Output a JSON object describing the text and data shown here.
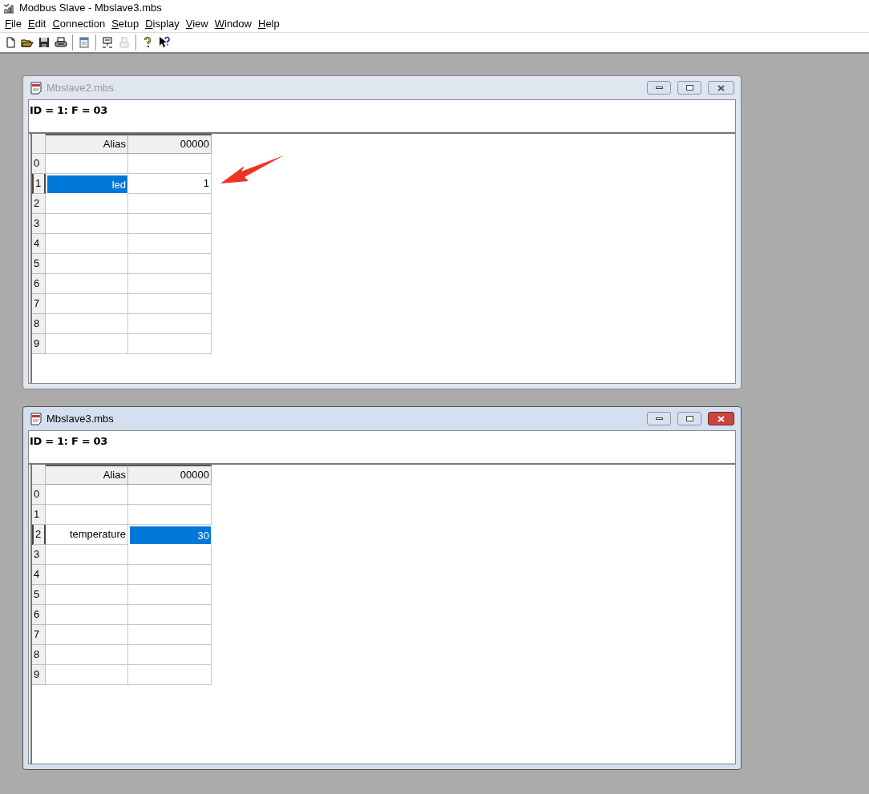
{
  "app": {
    "title": "Modbus Slave - Mbslave3.mbs"
  },
  "menu": [
    {
      "label": "File"
    },
    {
      "label": "Edit"
    },
    {
      "label": "Connection"
    },
    {
      "label": "Setup"
    },
    {
      "label": "Display"
    },
    {
      "label": "View"
    },
    {
      "label": "Window"
    },
    {
      "label": "Help"
    }
  ],
  "toolbar": [
    {
      "kind": "new",
      "disabled": false
    },
    {
      "kind": "open",
      "disabled": false
    },
    {
      "kind": "save",
      "disabled": false
    },
    {
      "kind": "print",
      "disabled": false
    },
    {
      "kind": "separator"
    },
    {
      "kind": "window",
      "disabled": false
    },
    {
      "kind": "separator"
    },
    {
      "kind": "connect",
      "disabled": false
    },
    {
      "kind": "disconnect",
      "disabled": true
    },
    {
      "kind": "separator"
    },
    {
      "kind": "help",
      "disabled": false
    },
    {
      "kind": "context-help",
      "disabled": false
    }
  ],
  "windows": [
    {
      "title": "Mbslave2.mbs",
      "active": false,
      "status_text": "ID = 1: F = 03",
      "columns": [
        "Alias",
        "00000"
      ],
      "rows": [
        {
          "index": "0",
          "cells": [
            {
              "text": "",
              "selected": false
            },
            {
              "text": "",
              "selected": false
            }
          ]
        },
        {
          "index": "1",
          "cells": [
            {
              "text": "led",
              "selected": true
            },
            {
              "text": "1",
              "selected": false
            }
          ]
        },
        {
          "index": "2",
          "cells": [
            {
              "text": "",
              "selected": false
            },
            {
              "text": "",
              "selected": false
            }
          ]
        },
        {
          "index": "3",
          "cells": [
            {
              "text": "",
              "selected": false
            },
            {
              "text": "",
              "selected": false
            }
          ]
        },
        {
          "index": "4",
          "cells": [
            {
              "text": "",
              "selected": false
            },
            {
              "text": "",
              "selected": false
            }
          ]
        },
        {
          "index": "5",
          "cells": [
            {
              "text": "",
              "selected": false
            },
            {
              "text": "",
              "selected": false
            }
          ]
        },
        {
          "index": "6",
          "cells": [
            {
              "text": "",
              "selected": false
            },
            {
              "text": "",
              "selected": false
            }
          ]
        },
        {
          "index": "7",
          "cells": [
            {
              "text": "",
              "selected": false
            },
            {
              "text": "",
              "selected": false
            }
          ]
        },
        {
          "index": "8",
          "cells": [
            {
              "text": "",
              "selected": false
            },
            {
              "text": "",
              "selected": false
            }
          ]
        },
        {
          "index": "9",
          "cells": [
            {
              "text": "",
              "selected": false
            },
            {
              "text": "",
              "selected": false
            }
          ]
        }
      ]
    },
    {
      "title": "Mbslave3.mbs",
      "active": true,
      "status_text": "ID = 1: F = 03",
      "columns": [
        "Alias",
        "00000"
      ],
      "rows": [
        {
          "index": "0",
          "cells": [
            {
              "text": "",
              "selected": false
            },
            {
              "text": "",
              "selected": false
            }
          ]
        },
        {
          "index": "1",
          "cells": [
            {
              "text": "",
              "selected": false
            },
            {
              "text": "",
              "selected": false
            }
          ]
        },
        {
          "index": "2",
          "cells": [
            {
              "text": "temperature",
              "selected": false
            },
            {
              "text": "30",
              "selected": true
            }
          ]
        },
        {
          "index": "3",
          "cells": [
            {
              "text": "",
              "selected": false
            },
            {
              "text": "",
              "selected": false
            }
          ]
        },
        {
          "index": "4",
          "cells": [
            {
              "text": "",
              "selected": false
            },
            {
              "text": "",
              "selected": false
            }
          ]
        },
        {
          "index": "5",
          "cells": [
            {
              "text": "",
              "selected": false
            },
            {
              "text": "",
              "selected": false
            }
          ]
        },
        {
          "index": "6",
          "cells": [
            {
              "text": "",
              "selected": false
            },
            {
              "text": "",
              "selected": false
            }
          ]
        },
        {
          "index": "7",
          "cells": [
            {
              "text": "",
              "selected": false
            },
            {
              "text": "",
              "selected": false
            }
          ]
        },
        {
          "index": "8",
          "cells": [
            {
              "text": "",
              "selected": false
            },
            {
              "text": "",
              "selected": false
            }
          ]
        },
        {
          "index": "9",
          "cells": [
            {
              "text": "",
              "selected": false
            },
            {
              "text": "",
              "selected": false
            }
          ]
        }
      ]
    }
  ]
}
